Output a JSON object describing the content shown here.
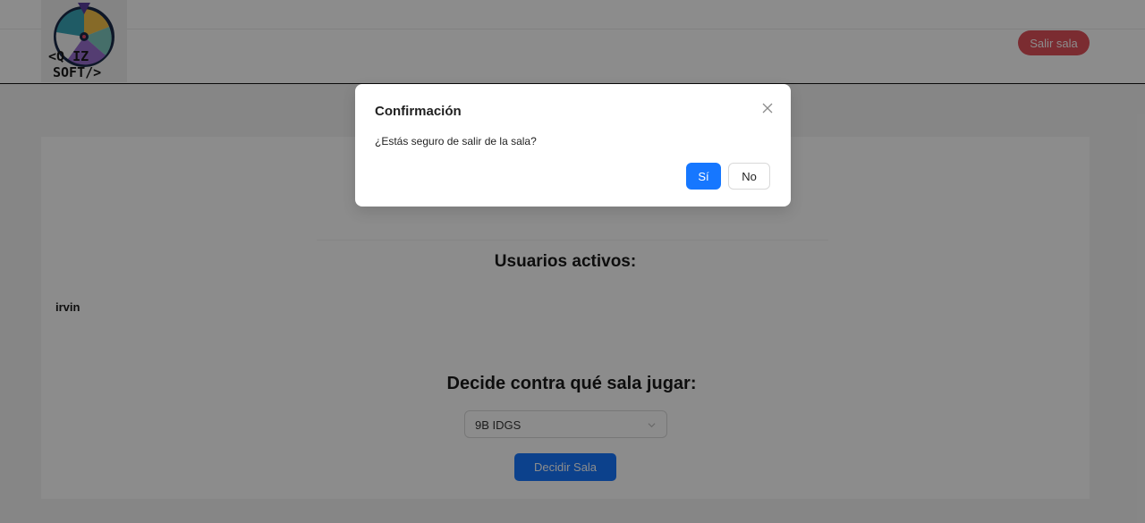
{
  "header": {
    "logo": {
      "line1": "<Q IZ",
      "line2": "SOFT/>"
    },
    "exit_button": "Salir sala"
  },
  "main": {
    "users_title": "Usuarios activos:",
    "users": [
      "irvin"
    ],
    "decide_title": "Decide contra qué sala jugar:",
    "room_select": {
      "selected": "9B IDGS"
    },
    "decide_button": "Decidir Sala"
  },
  "modal": {
    "title": "Confirmación",
    "message": "¿Estás seguro de salir de la sala?",
    "yes_label": "Sí",
    "no_label": "No"
  },
  "icons": {
    "close": "close-icon",
    "select_chevron": "chevron-down-icon"
  },
  "colors": {
    "primary": "#1677ff",
    "danger": "#e0505a",
    "mask": "rgba(0,0,0,0.45)"
  }
}
